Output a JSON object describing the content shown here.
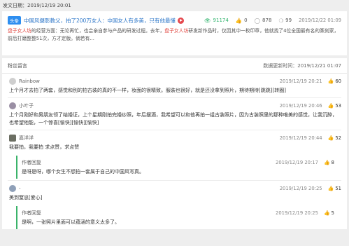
{
  "topbar": {
    "publish_date": "发文日期：2019/12/19 20:01"
  },
  "article": {
    "tag": "头条",
    "title": "中国风摄影教父，拍了200万女人：中国女人有多美，只有他最懂",
    "stats": {
      "views": "91174",
      "likes": "0",
      "comments": "878",
      "shares": "99"
    },
    "time": "2019/12/22 01:09",
    "body_parts": [
      "",
      "盘子女人坊",
      "的经营方面：无论再忙，也会亲自参与产品的研发过程。去年，",
      "盘子女人坊",
      "研发新作品时，仅因其中一枚印章，他就找了4位全国最有名的篆刻家，前后打磨整整51次，方才定版。倘若有..."
    ]
  },
  "comments_section": {
    "title": "粉丝留言",
    "updated": "数据更新时间：2019/12/21 01:07",
    "items": [
      {
        "user": "Rainbow",
        "time": "2019/12/19 20:21",
        "likes": "60",
        "text": "上个月才去拍了两套，感觉和别的拍古装的真的不一样，妆面的很精致。服装也很好，就是还没拿到照片，期待期待[跳跳][转圈]",
        "avatar_color": "#cccccc"
      },
      {
        "user": "小叶子",
        "time": "2019/12/19 20:46",
        "likes": "53",
        "text": "上个月刚好和男朋友领了结婚证，上个星期刚拍完婚纱照，年后摆酒，我希望可以和他再拍一组古装照片，因为古装照里的那种唯美的感觉，让我沉醉，也希望他能，一个惊喜[愉快][愉快][愉快]",
        "avatar_color": "#9a8fa4"
      },
      {
        "user": "嘉洋洋",
        "time": "2019/12/19 20:44",
        "likes": "52",
        "text": "我要拍，我要拍 求点赞，求点赞",
        "avatar_color": "#6b6e62",
        "reply": {
          "user": "作者回复",
          "time": "2019/12/19 20:17",
          "likes": "8",
          "text": "是呀是呀，哪个女生不想拍一套属于自己的中国风写真。"
        }
      },
      {
        "user": "-",
        "time": "2019/12/19 20:25",
        "likes": "51",
        "text": "美到窒息[爱心]",
        "avatar_color": "#8fa0b8",
        "reply": {
          "user": "作者回复",
          "time": "2019/12/19 20:25",
          "likes": "5",
          "text": "是啊，一张照片里面可以蕴涵的意义太多了。"
        }
      }
    ]
  },
  "colors": {
    "accent": "#2e8ef0",
    "highlight": "#e0443e",
    "reply_bar": "#3bb36a"
  }
}
